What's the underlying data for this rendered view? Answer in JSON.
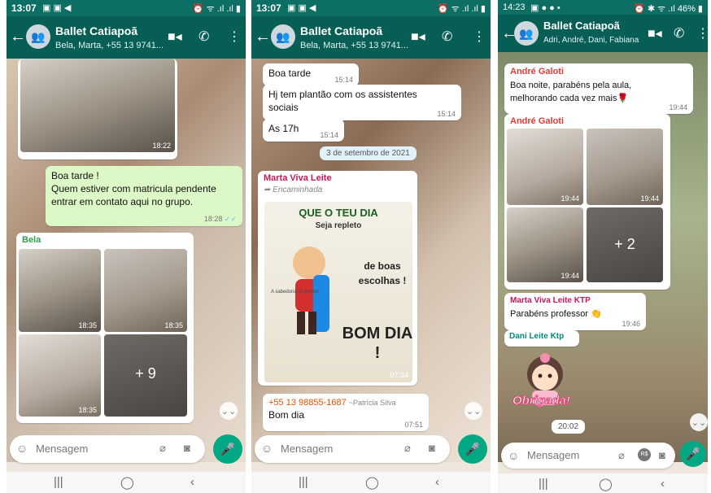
{
  "screens": [
    {
      "status": {
        "time": "13:07",
        "left_icons": "▣ ▣ ◀",
        "right_icons": "⏰ ᯤ .ıl .ıl ▮"
      },
      "header": {
        "title": "Ballet Catiapoã",
        "subtitle": "Bela, Marta, +55 13 9741..."
      },
      "messages": [
        {
          "time": "18:22"
        },
        {
          "text": "Boa tarde !\nQuem estiver com matricula pendente entrar em contato aqui no grupo.",
          "time": "18:28",
          "ticks": "✓✓"
        },
        {
          "sender": "Bela",
          "photos": [
            "18:35",
            "18:35",
            "18:35"
          ],
          "more": "+ 9"
        }
      ],
      "compose": {
        "placeholder": "Mensagem"
      }
    },
    {
      "status": {
        "time": "13:07",
        "left_icons": "▣ ▣ ◀",
        "right_icons": "⏰ ᯤ .ıl .ıl ▮"
      },
      "header": {
        "title": "Ballet Catiapoã",
        "subtitle": "Bela, Marta, +55 13 9741..."
      },
      "messages": [
        {
          "text": "Boa tarde",
          "time": "15:14"
        },
        {
          "text": "Hj tem plantão com os assistentes sociais",
          "time": "15:14"
        },
        {
          "text": "As 17h",
          "time": "15:14"
        },
        {
          "date": "3 de setembro de 2021"
        },
        {
          "sender": "Marta Viva Leite",
          "forwarded": "Encaminhada",
          "time": "07:34",
          "card": {
            "line1": "QUE O TEU DIA",
            "line2": "Seja repleto",
            "line3": "de boas escolhas !",
            "line4": "BOM DIA !",
            "small": "A sabedoria do humor"
          }
        },
        {
          "sender": "+55 13 98855-1687",
          "alias": "~Patrícia Silva",
          "text": "Bom dia",
          "time": "07:51"
        }
      ],
      "compose": {
        "placeholder": "Mensagem"
      }
    },
    {
      "status": {
        "time": "14:23",
        "left_icons": "▣ ● ● •",
        "right_icons": "⏰ ✱ ᯤ .ıl 46% ▮"
      },
      "header": {
        "title": "Ballet Catiapoã",
        "subtitle": "Adri, André, Dani, Fabiana M..."
      },
      "messages": [
        {
          "sender": "André Galoti",
          "text": "Boa noite, parabéns pela aula, melhorando cada vez mais🌹",
          "time": "19:44"
        },
        {
          "sender": "André Galoti",
          "photos": [
            "19:44",
            "19:44",
            "19:44"
          ],
          "more": "+ 2"
        },
        {
          "sender": "Marta Viva Leite KTP",
          "text": "Parabéns professor 👏",
          "time": "19:46"
        },
        {
          "sender": "Dani Leite Ktp",
          "sticker": "Obrigada!",
          "time": "20:02"
        }
      ],
      "compose": {
        "placeholder": "Mensagem",
        "rs": "R$"
      }
    }
  ],
  "colors": {
    "header": "#075e54",
    "status": "#0d6f63",
    "outgoing": "#dcf8c6",
    "mic": "#00a884",
    "sender_bela": "#2e9e4f",
    "sender_marta": "#c2185b",
    "sender_andre": "#e53935",
    "sender_dani": "#00897b"
  },
  "icons": [
    "back-arrow-icon",
    "video-call-icon",
    "phone-icon",
    "more-vert-icon",
    "emoji-icon",
    "attach-icon",
    "camera-icon",
    "mic-icon",
    "forward-icon",
    "scroll-down-icon"
  ],
  "navbar": {
    "recent": "|||",
    "home": "◯",
    "back": "‹"
  }
}
